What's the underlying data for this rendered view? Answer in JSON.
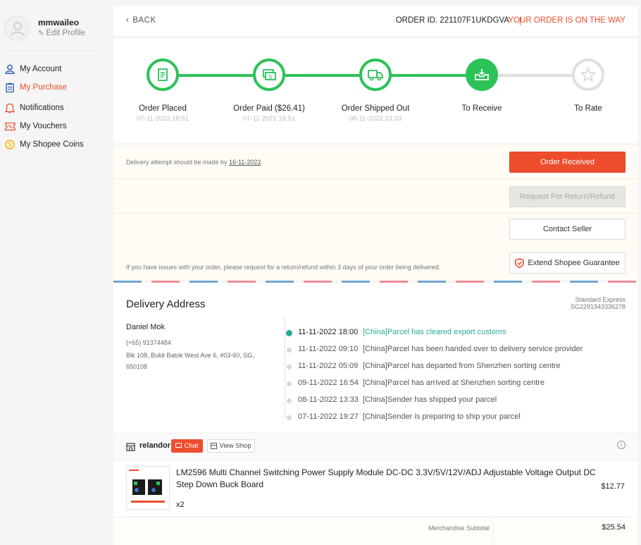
{
  "sidebar": {
    "username": "mmwaileo",
    "edit_profile": "Edit Profile",
    "items": [
      {
        "label": "My Account",
        "icon": "user-icon",
        "color": "#1a56b0"
      },
      {
        "label": "My Purchase",
        "icon": "clipboard-icon",
        "color": "#1a56b0",
        "active": true
      },
      {
        "label": "Notifications",
        "icon": "bell-icon",
        "color": "#ee4d2d"
      },
      {
        "label": "My Vouchers",
        "icon": "voucher-icon",
        "color": "#ee4d2d"
      },
      {
        "label": "My Shopee Coins",
        "icon": "coin-icon",
        "color": "#f6a700"
      }
    ]
  },
  "header": {
    "back": "BACK",
    "order_id": "ORDER ID. 221107F1UKDGVA",
    "separator": "|",
    "status": "YOUR ORDER IS ON THE WAY"
  },
  "stepper": {
    "progress": 0.75,
    "steps": [
      {
        "label": "Order Placed",
        "time": "07-11-2022 18:51",
        "icon": "receipt-icon",
        "state": "done"
      },
      {
        "label": "Order Paid ($26.41)",
        "time": "07-11-2022 18:51",
        "icon": "money-icon",
        "state": "done"
      },
      {
        "label": "Order Shipped Out",
        "time": "08-11-2022 13:33",
        "icon": "truck-icon",
        "state": "done"
      },
      {
        "label": "To Receive",
        "time": "",
        "icon": "inbox-download-icon",
        "state": "current"
      },
      {
        "label": "To Rate",
        "time": "",
        "icon": "star-icon",
        "state": "pending"
      }
    ]
  },
  "actions": {
    "delivery_note_prefix": "Delivery attempt should be made by ",
    "delivery_date": "16-11-2022",
    "delivery_note_suffix": ".",
    "order_received": "Order Received",
    "return_refund": "Request For Return/Refund",
    "contact_seller": "Contact Seller",
    "issue_note": "If you have issues with your order, please request for a return/refund within 3 days of your order being delivered.",
    "extend_guarantee": "Extend Shopee Guarantee"
  },
  "delivery": {
    "title": "Delivery Address",
    "courier": "Standard Express",
    "tracking": "SG2291943336278",
    "name": "Daniel Mok",
    "phone": "(+65) 91374484",
    "address": "Blk 108, Bukit Batok West Ave 6, #03-60, SG, 650108",
    "timeline": [
      {
        "time": "11-11-2022 18:00",
        "text": "[China]Parcel has cleared export customs",
        "current": true
      },
      {
        "time": "11-11-2022 09:10",
        "text": "[China]Parcel has been handed over to delivery service provider"
      },
      {
        "time": "11-11-2022 05:09",
        "text": "[China]Parcel has departed from Shenzhen sorting centre"
      },
      {
        "time": "09-11-2022 16:54",
        "text": "[China]Parcel has arrived at Shenzhen sorting centre"
      },
      {
        "time": "08-11-2022 13:33",
        "text": "[China]Sender has shipped your parcel"
      },
      {
        "time": "07-11-2022 19:27",
        "text": "[China]Sender is preparing to ship your parcel"
      }
    ]
  },
  "shop": {
    "name": "relandor",
    "chat": "Chat",
    "view_shop": "View Shop"
  },
  "product": {
    "name": "LM2596 Multi Channel Switching Power Supply Module DC-DC 3.3V/5V/12V/ADJ Adjustable Voltage Output DC Step Down Buck Board",
    "qty": "x2",
    "price": "$12.77"
  },
  "summary": {
    "subtotal_label": "Merchandise Subtotal",
    "subtotal_value": "$25.54"
  },
  "colors": {
    "accent": "#ee4d2d",
    "success": "#2dc258",
    "teal": "#26aa99"
  }
}
